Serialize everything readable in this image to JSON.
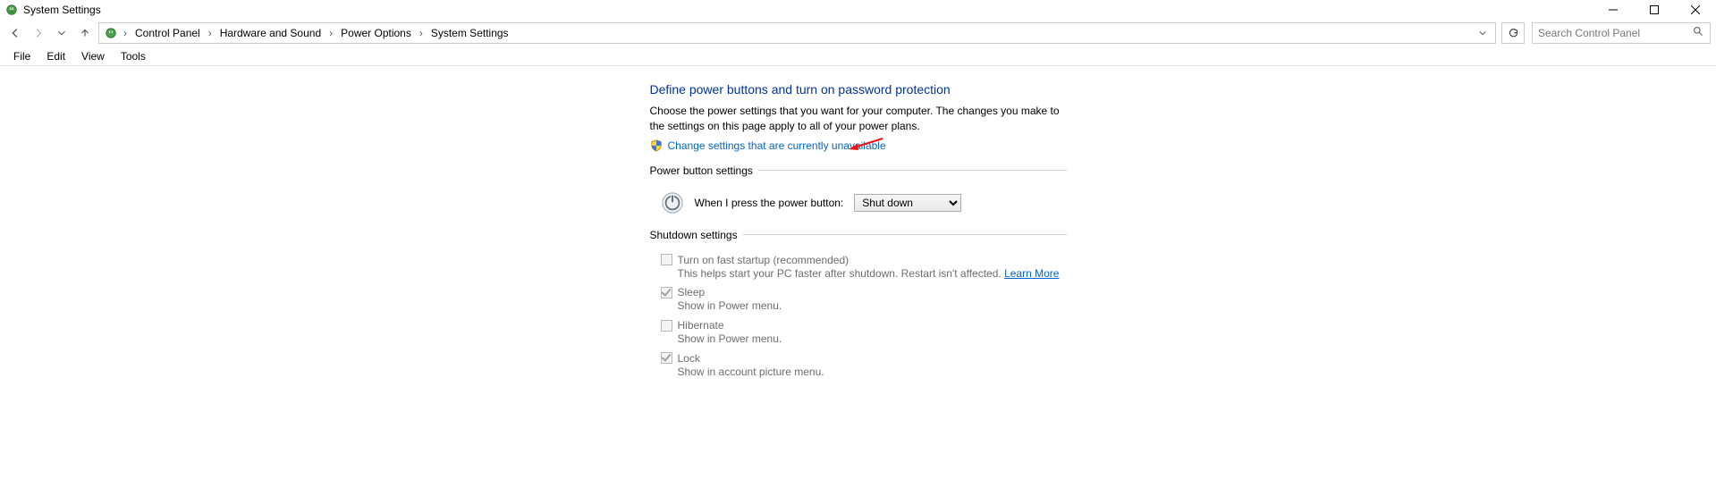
{
  "window": {
    "title": "System Settings"
  },
  "breadcrumb": {
    "items": [
      "Control Panel",
      "Hardware and Sound",
      "Power Options",
      "System Settings"
    ]
  },
  "search": {
    "placeholder": "Search Control Panel"
  },
  "menu": {
    "items": [
      "File",
      "Edit",
      "View",
      "Tools"
    ]
  },
  "main": {
    "heading": "Define power buttons and turn on password protection",
    "description": "Choose the power settings that you want for your computer. The changes you make to the settings on this page apply to all of your power plans.",
    "admin_link": "Change settings that are currently unavailable",
    "power_button_group": "Power button settings",
    "power_button_label": "When I press the power button:",
    "power_button_value": "Shut down",
    "shutdown_group": "Shutdown settings",
    "shutdown_items": [
      {
        "title": "Turn on fast startup (recommended)",
        "sub": "This helps start your PC faster after shutdown. Restart isn't affected. ",
        "link": "Learn More",
        "checked": false
      },
      {
        "title": "Sleep",
        "sub": "Show in Power menu.",
        "checked": true
      },
      {
        "title": "Hibernate",
        "sub": "Show in Power menu.",
        "checked": false
      },
      {
        "title": "Lock",
        "sub": "Show in account picture menu.",
        "checked": true
      }
    ]
  }
}
